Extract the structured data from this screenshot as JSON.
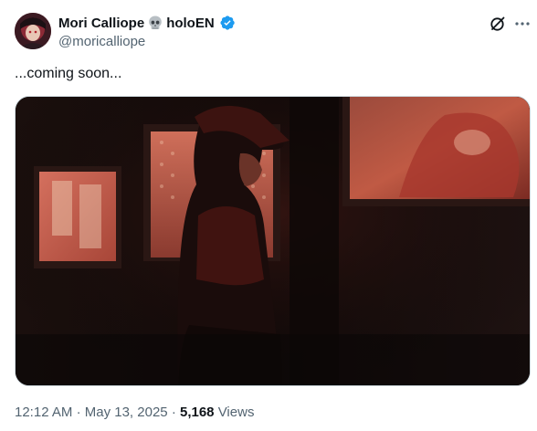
{
  "author": {
    "display_name": "Mori Calliope",
    "name_suffix": "holoEN",
    "handle": "@moricalliope",
    "verified": true,
    "badge_color": "#1d9bf0"
  },
  "tweet": {
    "text": "...coming soon..."
  },
  "meta": {
    "time": "12:12 AM",
    "separator": "·",
    "date": "May 13, 2025",
    "views_count": "5,168",
    "views_label": "Views"
  },
  "icons": {
    "grok": "grok-icon",
    "more": "more-options-icon",
    "verified": "verified-badge-icon",
    "skull": "skull-emoji-icon"
  },
  "colors": {
    "text_primary": "#0f1419",
    "text_secondary": "#536471",
    "accent": "#1d9bf0"
  }
}
